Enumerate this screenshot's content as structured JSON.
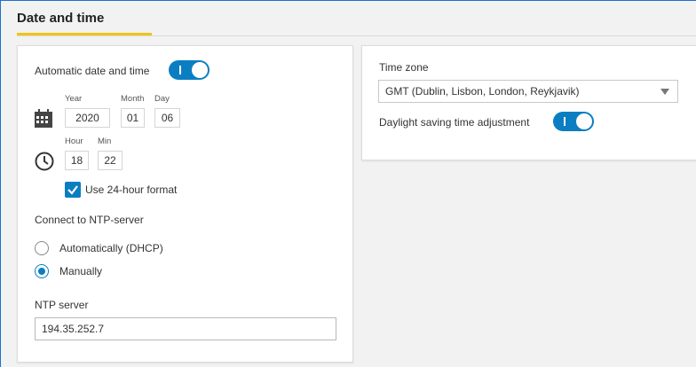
{
  "section": {
    "title": "Date and time"
  },
  "datetime": {
    "auto_label": "Automatic date and time",
    "auto_enabled": true,
    "year_label": "Year",
    "month_label": "Month",
    "day_label": "Day",
    "year": "2020",
    "month": "01",
    "day": "06",
    "hour_label": "Hour",
    "min_label": "Min",
    "hour": "18",
    "min": "22",
    "use24_label": "Use 24-hour format",
    "use24_checked": true,
    "calendar_icon": "calendar-icon",
    "clock_icon": "clock-icon"
  },
  "ntp": {
    "heading": "Connect to NTP-server",
    "options": [
      {
        "label": "Automatically (DHCP)",
        "selected": false
      },
      {
        "label": "Manually",
        "selected": true
      }
    ],
    "server_label": "NTP server",
    "server_value": "194.35.252.7"
  },
  "timezone": {
    "label": "Time zone",
    "selected": "GMT (Dublin, Lisbon, London, Reykjavik)",
    "dst_label": "Daylight saving time adjustment",
    "dst_enabled": true
  },
  "colors": {
    "accent": "#0b7ec2",
    "title_underline": "#f0c419"
  }
}
